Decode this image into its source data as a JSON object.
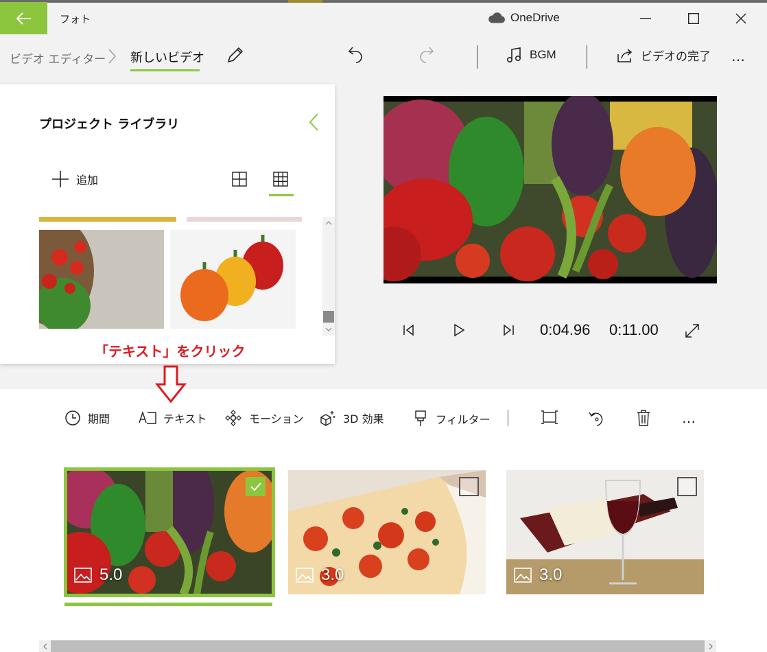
{
  "app": {
    "title": "フォト",
    "cloud_label": "OneDrive",
    "back_icon": "back-arrow-icon",
    "accent": "#8cc63f"
  },
  "toolbar": {
    "breadcrumb_parent": "ビデオ エディター",
    "breadcrumb_current": "新しいビデオ",
    "bgm_label": "BGM",
    "finish_label": "ビデオの完了",
    "more_label": "…"
  },
  "library": {
    "title": "プロジェクト ライブラリ",
    "add_label": "追加"
  },
  "annotation": {
    "text": "「テキスト」をクリック",
    "color": "#e0191f"
  },
  "player": {
    "current_time": "0:04.96",
    "total_time": "0:11.00"
  },
  "storyboard": {
    "tools": [
      {
        "label": "期間",
        "icon": "clock-icon"
      },
      {
        "label": "テキスト",
        "icon": "text-icon"
      },
      {
        "label": "モーション",
        "icon": "motion-icon"
      },
      {
        "label": "3D 効果",
        "icon": "3d-effects-icon"
      },
      {
        "label": "フィルター",
        "icon": "filter-icon"
      }
    ],
    "more_label": "…",
    "cards": [
      {
        "duration": "5.0",
        "selected": true
      },
      {
        "duration": "3.0",
        "selected": false
      },
      {
        "duration": "3.0",
        "selected": false
      }
    ]
  }
}
